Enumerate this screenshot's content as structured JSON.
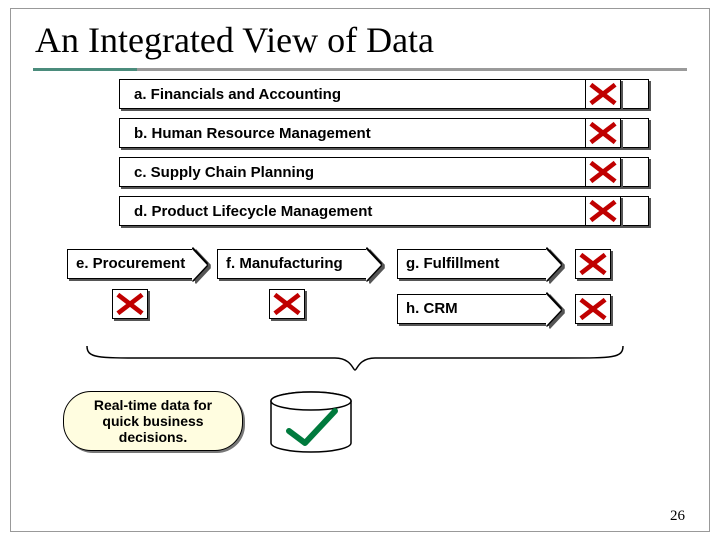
{
  "title": "An Integrated View of Data",
  "rows": {
    "a": "a. Financials and Accounting",
    "b": "b. Human Resource Management",
    "c": "c. Supply Chain Planning",
    "d": "d. Product Lifecycle Management",
    "e": "e. Procurement",
    "f": "f. Manufacturing",
    "g": "g. Fulfillment",
    "h": "h. CRM"
  },
  "callout": "Real-time data for quick business decisions.",
  "page_number": "26"
}
